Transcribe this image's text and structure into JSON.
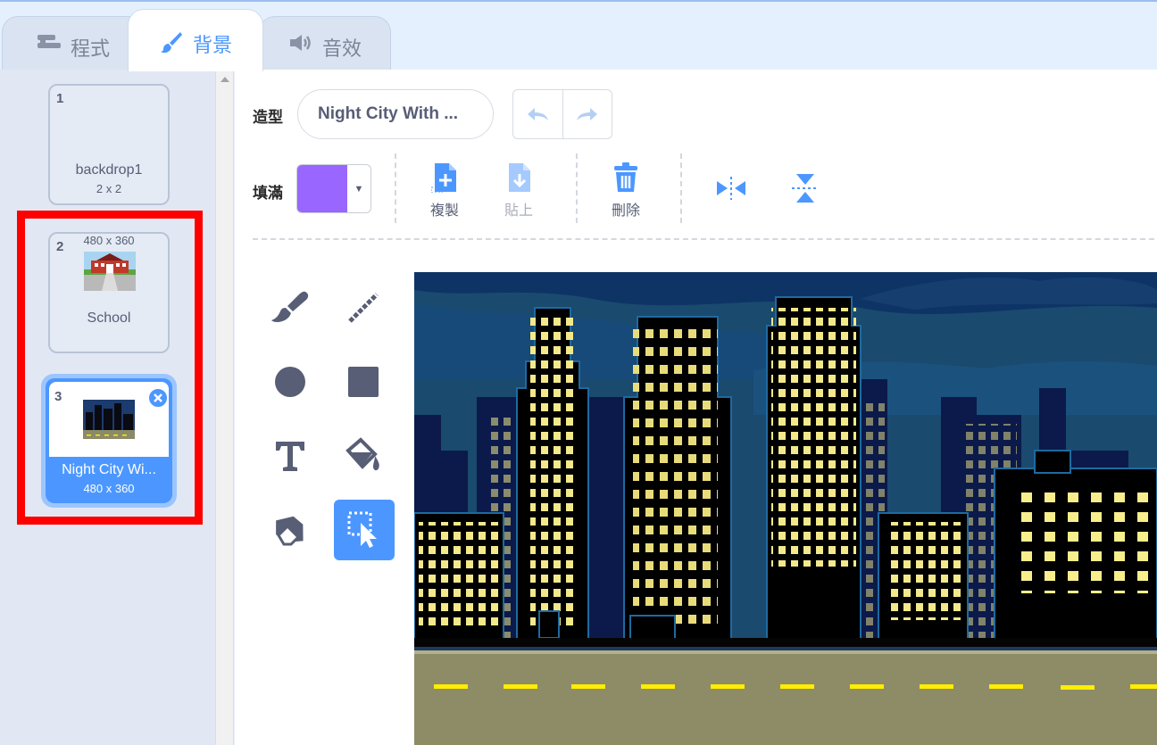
{
  "tabs": [
    {
      "id": "code",
      "label": "程式",
      "icon": "code-blocks-icon"
    },
    {
      "id": "backdrops",
      "label": "背景",
      "icon": "paintbrush-icon",
      "active": true
    },
    {
      "id": "sounds",
      "label": "音效",
      "icon": "speaker-icon"
    }
  ],
  "backdrops": [
    {
      "number": "1",
      "name": "backdrop1",
      "size": "2 x 2"
    },
    {
      "number": "2",
      "name": "School",
      "size": "480 x 360"
    },
    {
      "number": "3",
      "name": "Night City Wi...",
      "size": "480 x 360",
      "selected": true
    }
  ],
  "editor": {
    "costume_label": "造型",
    "costume_name": "Night City With ...",
    "fill_label": "填滿",
    "fill_color": "#9966ff",
    "actions": {
      "copy": "複製",
      "paste": "貼上",
      "delete": "刪除"
    }
  },
  "colors": {
    "accent": "#4c97ff",
    "highlight": "#ff0000"
  }
}
